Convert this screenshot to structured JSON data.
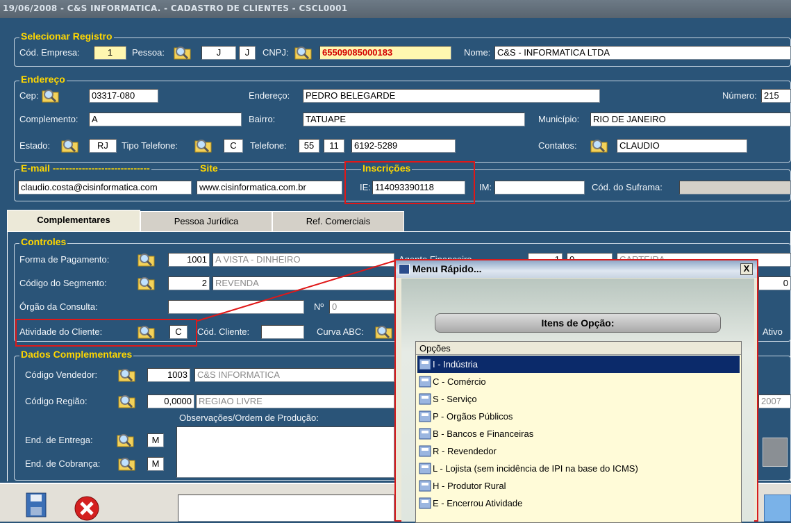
{
  "window": {
    "title": "19/06/2008 - C&S INFORMATICA. - CADASTRO DE CLIENTES - CSCL0001"
  },
  "selecionar": {
    "section": "Selecionar Registro",
    "cod_empresa_label": "Cód. Empresa:",
    "cod_empresa": "1",
    "pessoa_label": "Pessoa:",
    "pessoa_1": "J",
    "pessoa_2": "J",
    "cnpj_label": "CNPJ:",
    "cnpj": "65509085000183",
    "nome_label": "Nome:",
    "nome": "C&S - INFORMATICA LTDA"
  },
  "endereco": {
    "section": "Endereço",
    "cep_label": "Cep:",
    "cep": "03317-080",
    "endereco_label": "Endereço:",
    "endereco": "PEDRO BELEGARDE",
    "numero_label": "Número:",
    "numero": "215",
    "complemento_label": "Complemento:",
    "complemento": "A",
    "bairro_label": "Bairro:",
    "bairro": "TATUAPE",
    "municipio_label": "Município:",
    "municipio": "RIO DE JANEIRO",
    "estado_label": "Estado:",
    "estado": "RJ",
    "tipo_tel_label": "Tipo Telefone:",
    "tipo_tel": "C",
    "telefone_label": "Telefone:",
    "tel_ddi": "55",
    "tel_ddd": "11",
    "tel_num": "6192-5289",
    "contatos_label": "Contatos:",
    "contatos": "CLAUDIO"
  },
  "email": {
    "section": "E-mail ------------------------------",
    "value": "claudio.costa@cisinformatica.com"
  },
  "site": {
    "section": "Site",
    "value": "www.cisinformatica.com.br"
  },
  "inscricoes": {
    "section": "Inscrições",
    "ie_label": "IE:",
    "ie": "114093390118",
    "im_label": "IM:",
    "im": "",
    "suframa_label": "Cód. do Suframa:",
    "suframa": ""
  },
  "tabs": [
    {
      "label": "Complementares"
    },
    {
      "label": "Pessoa Jurídica"
    },
    {
      "label": "Ref. Comerciais"
    }
  ],
  "controles": {
    "section": "Controles",
    "forma_pag_label": "Forma de Pagamento:",
    "forma_pag_cod": "1001",
    "forma_pag_desc": "A VISTA - DINHEIRO",
    "agente_label": "Agente Financeiro",
    "agente_1": "1",
    "agente_2": "0",
    "agente_desc": "CARTEIRA",
    "segmento_label": "Código do Segmento:",
    "segmento_cod": "2",
    "segmento_desc": "REVENDA",
    "segmento_right": "0",
    "orgao_label": "Órgão da Consulta:",
    "orgao": "",
    "n_label": "Nº",
    "n_value": "0",
    "atividade_label": "Atividade do Cliente:",
    "atividade": "C",
    "cod_cliente_label": "Cód. Cliente:",
    "cod_cliente": "",
    "curva_label": "Curva ABC:",
    "ativo_label": "Ativo"
  },
  "dados": {
    "section": "Dados Complementares",
    "vendedor_label": "Código Vendedor:",
    "vendedor_cod": "1003",
    "vendedor_desc": "C&S INFORMATICA",
    "regiao_label": "Código Região:",
    "regiao_cod": "0,0000",
    "regiao_desc": "REGIAO LIVRE",
    "regiao_right": "2007",
    "obs_label": "Observações/Ordem de Produção:",
    "entrega_label": "End. de Entrega:",
    "entrega": "M",
    "cobranca_label": "End. de Cobrança:",
    "cobranca": "M"
  },
  "popup": {
    "title": "Menu Rápido...",
    "close": "X",
    "header": "Itens de Opção:",
    "column": "Opções",
    "options": [
      {
        "label": "I - Indústria"
      },
      {
        "label": "C - Comércio"
      },
      {
        "label": "S - Serviço"
      },
      {
        "label": "P - Orgãos Públicos"
      },
      {
        "label": "B - Bancos e Financeiras"
      },
      {
        "label": "R - Revendedor"
      },
      {
        "label": "L - Lojista (sem incidência de IPI na base do ICMS)"
      },
      {
        "label": "H - Produtor Rural"
      },
      {
        "label": "E - Encerrou Atividade"
      }
    ]
  },
  "colors": {
    "background": "#2a5478",
    "section": "#ffd700",
    "highlight": "#e01818",
    "selected": "#0b2a6a"
  }
}
